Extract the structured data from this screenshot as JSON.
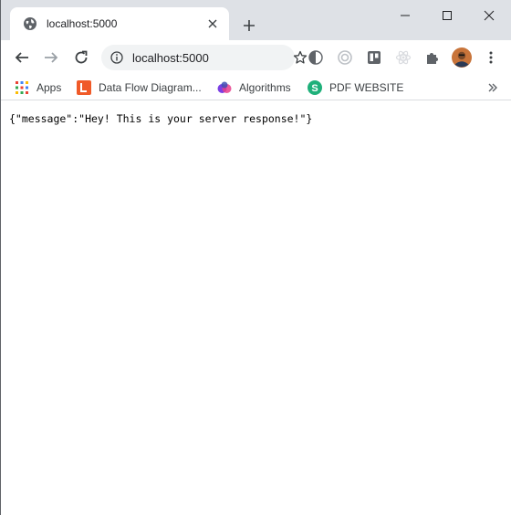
{
  "tab": {
    "title": "localhost:5000"
  },
  "toolbar": {
    "url": "localhost:5000"
  },
  "bookmarks": [
    {
      "label": "Apps",
      "icon": "apps-grid-icon"
    },
    {
      "label": "Data Flow Diagram...",
      "icon": "lucidchart-icon"
    },
    {
      "label": "Algorithms",
      "icon": "algorithms-icon"
    },
    {
      "label": "PDF WEBSITE",
      "icon": "pdf-website-icon"
    }
  ],
  "content": {
    "response": "{\"message\":\"Hey! This is your server response!\"}"
  },
  "colors": {
    "tabstrip": "#dee1e6",
    "omnibox": "#f1f3f4",
    "icon_gray": "#5f6368",
    "lucid_orange": "#f05a28",
    "pdf_green": "#1fb07a"
  }
}
